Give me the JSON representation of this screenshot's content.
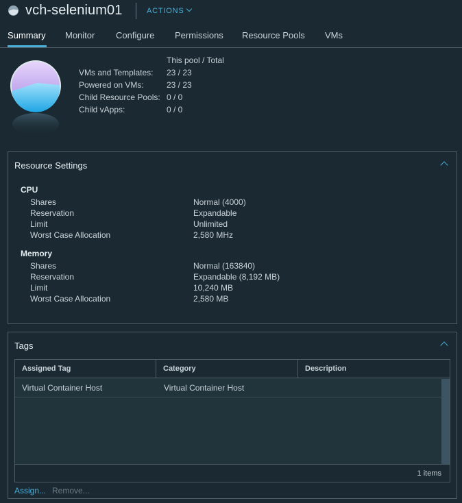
{
  "header": {
    "title": "vch-selenium01",
    "actions_label": "ACTIONS",
    "icon": "resource-pool-icon"
  },
  "tabs": [
    {
      "label": "Summary",
      "active": true
    },
    {
      "label": "Monitor",
      "active": false
    },
    {
      "label": "Configure",
      "active": false
    },
    {
      "label": "Permissions",
      "active": false
    },
    {
      "label": "Resource Pools",
      "active": false
    },
    {
      "label": "VMs",
      "active": false
    }
  ],
  "summary": {
    "column_header": "This pool / Total",
    "rows": [
      {
        "label": "VMs and Templates:",
        "value": "23 / 23"
      },
      {
        "label": "Powered on VMs:",
        "value": "23 / 23"
      },
      {
        "label": "Child Resource Pools:",
        "value": "0 / 0"
      },
      {
        "label": "Child vApps:",
        "value": "0 / 0"
      }
    ]
  },
  "resource_settings": {
    "title": "Resource Settings",
    "cpu": {
      "heading": "CPU",
      "rows": [
        {
          "label": "Shares",
          "value": "Normal (4000)"
        },
        {
          "label": "Reservation",
          "value": "Expandable"
        },
        {
          "label": "Limit",
          "value": "Unlimited"
        },
        {
          "label": "Worst Case Allocation",
          "value": "2,580 MHz"
        }
      ]
    },
    "memory": {
      "heading": "Memory",
      "rows": [
        {
          "label": "Shares",
          "value": "Normal (163840)"
        },
        {
          "label": "Reservation",
          "value": "Expandable (8,192 MB)"
        },
        {
          "label": "Limit",
          "value": "10,240 MB"
        },
        {
          "label": "Worst Case Allocation",
          "value": "2,580 MB"
        }
      ]
    }
  },
  "tags": {
    "title": "Tags",
    "columns": [
      "Assigned Tag",
      "Category",
      "Description"
    ],
    "rows": [
      {
        "assigned_tag": "Virtual Container Host",
        "category": "Virtual Container Host",
        "description": ""
      }
    ],
    "footer_count": "1 items",
    "assign_label": "Assign...",
    "remove_label": "Remove..."
  },
  "colors": {
    "background": "#1b2a32",
    "accent": "#49afd9",
    "border": "#4e5d66"
  }
}
